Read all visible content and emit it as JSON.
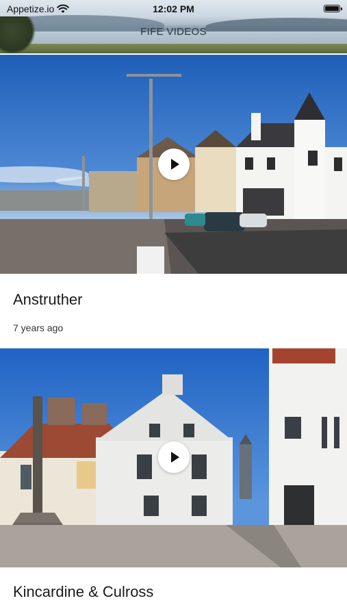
{
  "status_bar": {
    "carrier": "Appetize.io",
    "time": "12:02 PM"
  },
  "app": {
    "title": "FIFE VIDEOS"
  },
  "videos": [
    {
      "title": "Anstruther",
      "meta": "7 years ago",
      "thumbnail": "harbour-street-scene"
    },
    {
      "title": "Kincardine & Culross",
      "thumbnail": "white-houses-mercat-cross"
    }
  ],
  "icons": {
    "wifi": "wifi-icon",
    "battery": "battery-icon",
    "play": "play-icon"
  }
}
